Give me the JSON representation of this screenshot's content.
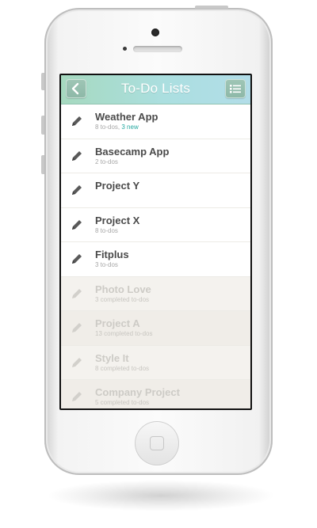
{
  "nav": {
    "title": "To-Do Lists",
    "back_icon": "chevron-left-icon",
    "menu_icon": "list-icon"
  },
  "lists": [
    {
      "title": "Weather App",
      "subtitle": "8 to-dos,",
      "badge": "3 new",
      "state": "active"
    },
    {
      "title": "Basecamp App",
      "subtitle": "2 to-dos",
      "badge": "",
      "state": "active"
    },
    {
      "title": "Project Y",
      "subtitle": "",
      "badge": "",
      "state": "active"
    },
    {
      "title": "Project X",
      "subtitle": "8 to-dos",
      "badge": "",
      "state": "active"
    },
    {
      "title": "Fitplus",
      "subtitle": "3 to-dos",
      "badge": "",
      "state": "active"
    },
    {
      "title": "Photo Love",
      "subtitle": "3 completed to-dos",
      "badge": "",
      "state": "completed"
    },
    {
      "title": "Project A",
      "subtitle": "13 completed to-dos",
      "badge": "",
      "state": "completed"
    },
    {
      "title": "Style It",
      "subtitle": "8 completed to-dos",
      "badge": "",
      "state": "completed"
    },
    {
      "title": "Company Project",
      "subtitle": "5 completed to-dos",
      "badge": "",
      "state": "completed"
    }
  ],
  "colors": {
    "nav_gradient_start": "#a6d9bf",
    "nav_gradient_end": "#b2dde8",
    "new_badge": "#24a8a0",
    "active_pencil": "#5a5a5a",
    "completed_pencil": "#cfcdc8"
  }
}
